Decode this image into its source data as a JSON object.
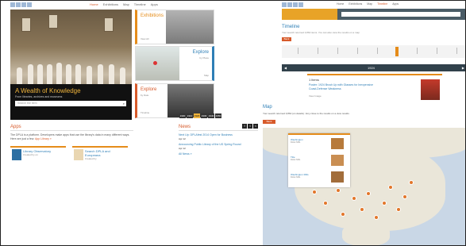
{
  "left": {
    "nav": [
      "Home",
      "Exhibitions",
      "Map",
      "Timeline",
      "Apps"
    ],
    "hero": {
      "title": "A Wealth of Knowledge",
      "subtitle": "From libraries, archives and museums",
      "search_placeholder": "Search the item"
    },
    "tiles": [
      {
        "label": "Exhibitions",
        "more": "View All"
      },
      {
        "label": "Explore",
        "sub": "by Place",
        "more": "Map"
      },
      {
        "label": "Explore",
        "sub": "by Date",
        "more": "Timeline"
      }
    ],
    "decades": [
      "1900",
      "1910",
      "1920",
      "1930",
      "1940",
      "1950"
    ],
    "apps": {
      "heading": "Apps",
      "text": "The DPLA is a platform. Developers make apps that use the library's data in many different ways. Here are just a few.",
      "link": "App Library »",
      "cards": [
        {
          "title": "Library Observatory",
          "by": "Created by on"
        },
        {
          "title": "Search DPLA and Europeana",
          "by": "Created by"
        }
      ]
    },
    "news": {
      "heading": "News",
      "items": [
        {
          "text": "Next Up: DPLAfest 2014 Open for Business",
          "date": "Apr 12"
        },
        {
          "text": "Announcing Public Library of the US Spring Round",
          "date": "Apr 12"
        }
      ],
      "more": "All News »"
    }
  },
  "right": {
    "nav": [
      "Home",
      "Exhibitions",
      "Map",
      "Timeline",
      "Apps"
    ],
    "timeline": {
      "title": "Timeline",
      "subtitle": "Your search returned 3,864 items. You can also view the results on a map",
      "button": "Back",
      "year": "1924"
    },
    "event": {
      "title": "1 ltems",
      "link": "Poster: 1924 Brush Up with Glasses for Inexpensive Coast-Defense Weakness",
      "meta": "View Image"
    },
    "map": {
      "title": "Map",
      "subtitle": "Your search returned 3,864 (on details). Very close to the results on a view results.",
      "button": "Back",
      "popup_items": [
        {
          "title": "Washington",
          "sub": "Dolan Mills"
        },
        {
          "title": "Title",
          "sub": "Dolan Mills"
        },
        {
          "title": "Washington Mills",
          "sub": "Dolan Mills"
        }
      ]
    }
  }
}
